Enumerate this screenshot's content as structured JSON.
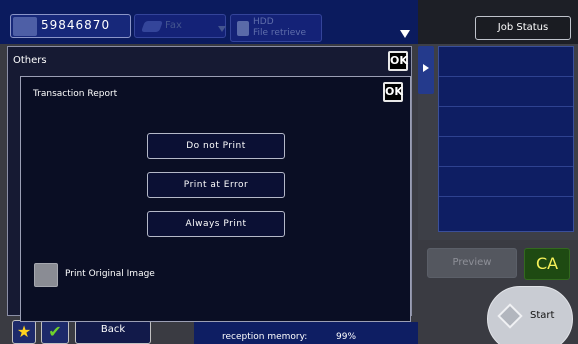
{
  "top_bar": {
    "destination_number": "59846870",
    "fax_label": "Fax",
    "hdd_line1": "HDD",
    "hdd_line2": "File retrieve",
    "job_status_label": "Job Status"
  },
  "others_dialog": {
    "title": "Others",
    "ok_label": "OK"
  },
  "transaction_report": {
    "title": "Transaction Report",
    "ok_label": "OK",
    "options": [
      "Do not Print",
      "Print at Error",
      "Always Print"
    ],
    "checkbox_label": "Print Original Image",
    "checkbox_checked": false
  },
  "right_panel": {
    "preview_label": "Preview",
    "ca_label": "CA",
    "start_label": "Start"
  },
  "bottom_bar": {
    "back_label": "Back",
    "memory_label": "reception memory:",
    "memory_value": "99%"
  },
  "colors": {
    "screen_blue": "#0e1e63",
    "dialog_bg": "#0a0e24",
    "ca_text": "#f7f25a",
    "checkmark": "#6fd12b",
    "star": "#ffd21e"
  },
  "icons": [
    "fax-destination-icon",
    "fax-icon",
    "hdd-icon",
    "dropdown-arrow-icon",
    "expand-arrow-icon",
    "favorite-star-icon",
    "check-icon",
    "start-diamond-icon"
  ]
}
